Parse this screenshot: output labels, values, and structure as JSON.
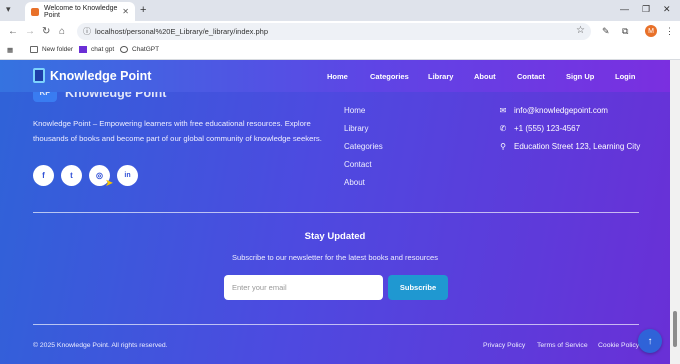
{
  "browser": {
    "tab_title": "Welcome to Knowledge Point",
    "url": "localhost/personal%20E_Library/e_library/index.php",
    "profile_initial": "M",
    "bookmarks": [
      "New folder",
      "chat gpt",
      "ChatGPT"
    ]
  },
  "navbar": {
    "brand": "Knowledge Point",
    "links": [
      "Home",
      "Categories",
      "Library",
      "About",
      "Contact",
      "Sign Up",
      "Login"
    ]
  },
  "footer": {
    "hidden_brand": "Knowledge Point",
    "hidden_logo": "KP",
    "about_text": "Knowledge Point – Empowering learners with free educational resources. Explore thousands of books and become part of our global community of knowledge seekers.",
    "social": [
      {
        "icon": "f",
        "name": "facebook-icon"
      },
      {
        "icon": "t",
        "name": "twitter-icon"
      },
      {
        "icon": "◎",
        "name": "instagram-icon"
      },
      {
        "icon": "in",
        "name": "linkedin-icon"
      }
    ],
    "quick_links": [
      "Home",
      "Library",
      "Categories",
      "Contact",
      "About"
    ],
    "contact": {
      "email": "info@knowledgepoint.com",
      "phone": "+1 (555) 123-4567",
      "address": "Education Street 123, Learning City"
    },
    "newsletter": {
      "title": "Stay Updated",
      "subtitle": "Subscribe to our newsletter for the latest books and resources",
      "placeholder": "Enter your email",
      "button": "Subscribe"
    },
    "copyright": "© 2025 Knowledge Point. All rights reserved.",
    "legal_links": [
      "Privacy Policy",
      "Terms of Service",
      "Cookie Policy"
    ]
  },
  "colors": {
    "gradient_start": "#2f63d8",
    "gradient_end": "#6a2fd6",
    "subscribe": "#1f98d1"
  }
}
